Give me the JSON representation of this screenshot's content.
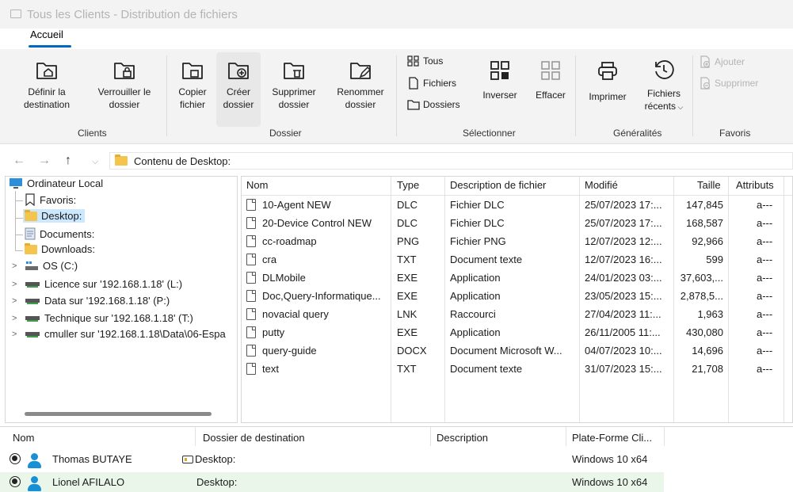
{
  "window": {
    "title": "Tous les Clients - Distribution de fichiers"
  },
  "tabs": {
    "active": "Accueil"
  },
  "ribbon": {
    "clients": {
      "label": "Clients",
      "set_destination": [
        "Définir la",
        "destination"
      ],
      "lock_folder": [
        "Verrouiller le",
        "dossier"
      ]
    },
    "dossier": {
      "label": "Dossier",
      "copy_file": [
        "Copier",
        "fichier"
      ],
      "create_folder": [
        "Créer",
        "dossier"
      ],
      "delete_folder": [
        "Supprimer",
        "dossier"
      ],
      "rename_folder": [
        "Renommer",
        "dossier"
      ]
    },
    "select": {
      "label": "Sélectionner",
      "all": "Tous",
      "files": "Fichiers",
      "folders": "Dossiers",
      "invert": "Inverser",
      "clear": "Effacer"
    },
    "general": {
      "label": "Généralités",
      "print": "Imprimer",
      "recent": [
        "Fichiers",
        "récents"
      ]
    },
    "favorites": {
      "label": "Favoris",
      "add": "Ajouter",
      "remove": "Supprimer"
    }
  },
  "address": {
    "path": "Contenu de Desktop:"
  },
  "tree": {
    "root": "Ordinateur Local",
    "items": [
      {
        "label": "Favoris:",
        "icon": "bookmark-icon"
      },
      {
        "label": "Desktop:",
        "icon": "folder-icon",
        "selected": true
      },
      {
        "label": "Documents:",
        "icon": "document-icon"
      },
      {
        "label": "Downloads:",
        "icon": "folder-icon"
      },
      {
        "label": "OS (C:)",
        "icon": "drive-icon"
      },
      {
        "label": "Licence sur '192.168.1.18' (L:)",
        "icon": "network-drive-icon"
      },
      {
        "label": "Data sur '192.168.1.18' (P:)",
        "icon": "network-drive-icon"
      },
      {
        "label": "Technique sur '192.168.1.18' (T:)",
        "icon": "network-drive-icon"
      },
      {
        "label": "cmuller sur '192.168.1.18\\Data\\06-Espa",
        "icon": "network-drive-icon"
      }
    ]
  },
  "files": {
    "columns": [
      "Nom",
      "Type",
      "Description de fichier",
      "Modifié",
      "Taille",
      "Attributs"
    ],
    "rows": [
      [
        "10-Agent NEW",
        "DLC",
        "Fichier DLC",
        "25/07/2023 17:...",
        "147,845",
        "a---"
      ],
      [
        "20-Device Control NEW",
        "DLC",
        "Fichier DLC",
        "25/07/2023 17:...",
        "168,587",
        "a---"
      ],
      [
        "cc-roadmap",
        "PNG",
        "Fichier PNG",
        "12/07/2023 12:...",
        "92,966",
        "a---"
      ],
      [
        "cra",
        "TXT",
        "Document texte",
        "12/07/2023 16:...",
        "599",
        "a---"
      ],
      [
        "DLMobile",
        "EXE",
        "Application",
        "24/01/2023 03:...",
        "37,603,...",
        "a---"
      ],
      [
        "Doc,Query-Informatique...",
        "EXE",
        "Application",
        "23/05/2023 15:...",
        "2,878,5...",
        "a---"
      ],
      [
        "novacial query",
        "LNK",
        "Raccourci",
        "27/04/2023 11:...",
        "1,963",
        "a---"
      ],
      [
        "putty",
        "EXE",
        "Application",
        "26/11/2005 11:...",
        "430,080",
        "a---"
      ],
      [
        "query-guide",
        "DOCX",
        "Document Microsoft W...",
        "04/07/2023 10:...",
        "14,696",
        "a---"
      ],
      [
        "text",
        "TXT",
        "Document texte",
        "31/07/2023 15:...",
        "21,708",
        "a---"
      ]
    ]
  },
  "clients": {
    "columns": [
      "Nom",
      "Dossier de destination",
      "Description",
      "Plate-Forme Cli..."
    ],
    "rows": [
      {
        "name": "Thomas BUTAYE",
        "dest": "Desktop:",
        "desc": "",
        "platform": "Windows 10 x64"
      },
      {
        "name": "Lionel AFILALO",
        "dest": "Desktop:",
        "desc": "",
        "platform": "Windows 10 x64"
      }
    ]
  },
  "colors": {
    "accent": "#0067c0",
    "selection": "#cce8ff",
    "selected_row": "#e9f6e9",
    "user_icon": "#1890d6"
  }
}
